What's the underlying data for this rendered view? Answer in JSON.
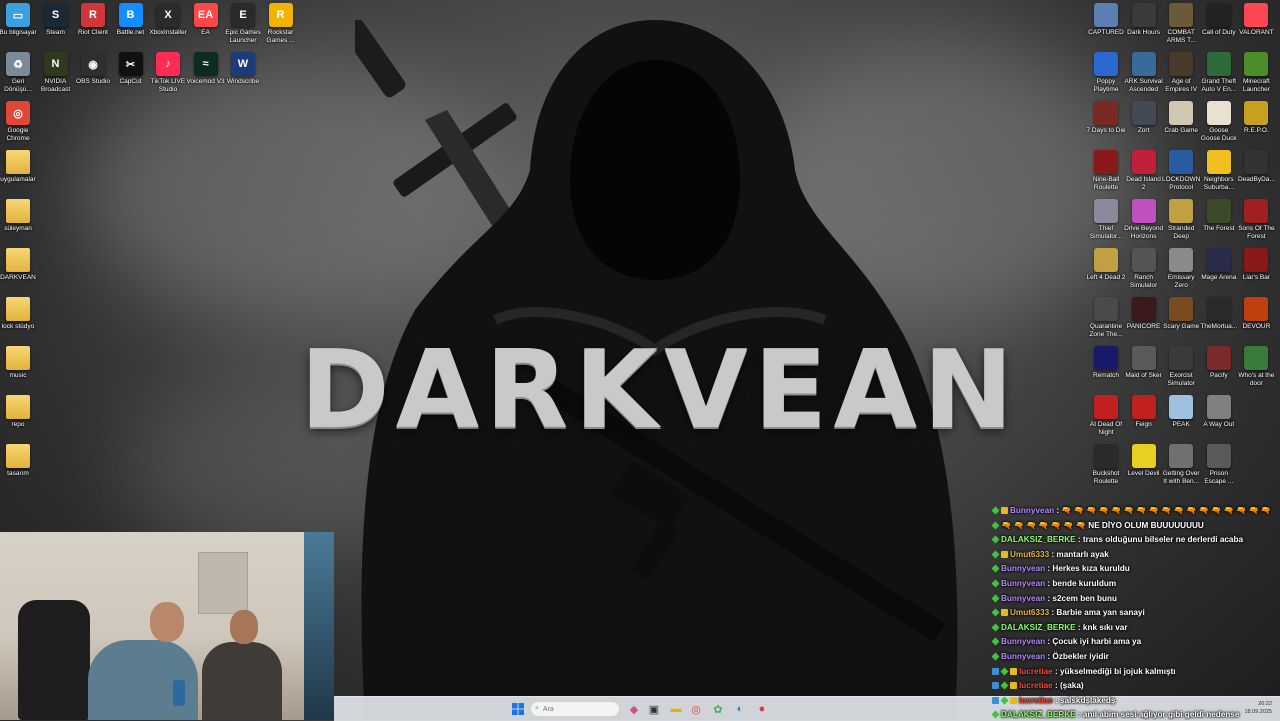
{
  "wallpaper": {
    "title": "DARKVEAN"
  },
  "desktop": {
    "left_icons": [
      {
        "label": "Bu bilgisayar",
        "glyph": "▭",
        "color": "#3aa0e0",
        "icon": "computer-icon"
      },
      {
        "label": "Steam",
        "glyph": "S",
        "color": "#1b2838",
        "icon": "steam-icon"
      },
      {
        "label": "Riot Client",
        "glyph": "R",
        "color": "#d13639",
        "icon": "riot-icon"
      },
      {
        "label": "Battle.net",
        "glyph": "B",
        "color": "#148eff",
        "icon": "battlenet-icon"
      },
      {
        "label": "XboxInstaller",
        "glyph": "X",
        "color": "#2b2b2b",
        "icon": "xbox-icon"
      },
      {
        "label": "EA",
        "glyph": "EA",
        "color": "#ff4747",
        "icon": "ea-icon"
      },
      {
        "label": "Epic Games Launcher",
        "glyph": "E",
        "color": "#2a2a2a",
        "icon": "epic-icon"
      },
      {
        "label": "Rockstar Games ...",
        "glyph": "R",
        "color": "#f0b400",
        "icon": "rockstar-icon"
      },
      {
        "label": "Geri Dönüşü...",
        "glyph": "♻",
        "color": "#7a8a99",
        "icon": "recycle-bin-icon"
      },
      {
        "label": "NVIDIA Broadcast",
        "glyph": "N",
        "color": "#2f3a1d",
        "icon": "nvidia-icon"
      },
      {
        "label": "OBS Studio",
        "glyph": "◉",
        "color": "#302e31",
        "icon": "obs-icon"
      },
      {
        "label": "CapCut",
        "glyph": "✂",
        "color": "#111111",
        "icon": "capcut-icon"
      },
      {
        "label": "TikTok LIVE Studio",
        "glyph": "♪",
        "color": "#fe2c55",
        "icon": "tiktok-icon"
      },
      {
        "label": "Voicemod V3",
        "glyph": "≈",
        "color": "#0b2b25",
        "icon": "voicemod-icon"
      },
      {
        "label": "Windscribe",
        "glyph": "W",
        "color": "#1d3b7a",
        "icon": "windscribe-icon"
      },
      {
        "label": "Google Chrome",
        "glyph": "◎",
        "color": "#e0463a",
        "icon": "chrome-icon"
      },
      {
        "label": "uygulamalar",
        "glyph": "",
        "color": "#f1c24f",
        "icon": "folder-icon"
      },
      {
        "label": "süleyman",
        "glyph": "",
        "color": "#f1c24f",
        "icon": "folder-icon"
      },
      {
        "label": "DARKVEAN",
        "glyph": "",
        "color": "#f1c24f",
        "icon": "folder-icon"
      },
      {
        "label": "lock stüdyo",
        "glyph": "",
        "color": "#f1c24f",
        "icon": "folder-icon"
      },
      {
        "label": "music",
        "glyph": "",
        "color": "#f1c24f",
        "icon": "folder-icon"
      },
      {
        "label": "repo",
        "glyph": "",
        "color": "#f1c24f",
        "icon": "folder-icon"
      },
      {
        "label": "tasarım",
        "glyph": "",
        "color": "#f1c24f",
        "icon": "folder-icon"
      }
    ],
    "right_icons": [
      {
        "label": "CAPTURED",
        "color": "#5a7fb0"
      },
      {
        "label": "Dark Hours",
        "color": "#3a3a3a"
      },
      {
        "label": "COMBAT ARMS T...",
        "color": "#6a5a3a"
      },
      {
        "label": "Call of Duty",
        "color": "#222222"
      },
      {
        "label": "VALORANT",
        "color": "#ff4655"
      },
      {
        "label": "Poppy Playtime",
        "color": "#2a6ad0"
      },
      {
        "label": "ARK Survival Ascended",
        "color": "#3a6a9a"
      },
      {
        "label": "Age of Empires IV",
        "color": "#4a3a2a"
      },
      {
        "label": "Grand Theft Auto V En...",
        "color": "#2f6a3a"
      },
      {
        "label": "Minecraft Launcher",
        "color": "#4c8c2b"
      },
      {
        "label": "7 Days to Die",
        "color": "#7a2a20"
      },
      {
        "label": "Zort",
        "color": "#444a55"
      },
      {
        "label": "Crab Game",
        "color": "#d0c8b0"
      },
      {
        "label": "Goose Goose Duck",
        "color": "#e8e0d0"
      },
      {
        "label": "R.E.P.O.",
        "color": "#c8a020"
      },
      {
        "label": "Nine-Ball Roulette",
        "color": "#8a1a1a"
      },
      {
        "label": "Dead Island 2",
        "color": "#c0203a"
      },
      {
        "label": "LOCKDOWN Protocol",
        "color": "#2a5aa0"
      },
      {
        "label": "Neighbors Suburba...",
        "color": "#f0c020"
      },
      {
        "label": "DeadByDa...",
        "color": "#333333"
      },
      {
        "label": "Thief Simulator...",
        "color": "#8a8a9a"
      },
      {
        "label": "Drive Beyond Horizons",
        "color": "#c050c0"
      },
      {
        "label": "Stranded Deep",
        "color": "#c0a040"
      },
      {
        "label": "The Forest",
        "color": "#3a4a2a"
      },
      {
        "label": "Sons Of The Forest",
        "color": "#a02020"
      },
      {
        "label": "Left 4 Dead 2",
        "color": "#c0a040"
      },
      {
        "label": "Ranch Simulator",
        "color": "#555555"
      },
      {
        "label": "Emissary Zero",
        "color": "#8a8a8a"
      },
      {
        "label": "Mage Arena",
        "color": "#2a2a4a"
      },
      {
        "label": "Liar's Bar",
        "color": "#8a1a1a"
      },
      {
        "label": "Quarantine Zone The...",
        "color": "#4a4a4a"
      },
      {
        "label": "PANICORE",
        "color": "#3a1a1a"
      },
      {
        "label": "Scary Game",
        "color": "#7a4a20"
      },
      {
        "label": "TheMortua...",
        "color": "#2a2a2a"
      },
      {
        "label": "DEVOUR",
        "color": "#c04010"
      },
      {
        "label": "Rematch",
        "color": "#1a1a6a"
      },
      {
        "label": "Maid of Sker",
        "color": "#5a5a5a"
      },
      {
        "label": "Exorcist Simulator",
        "color": "#3a3a3a"
      },
      {
        "label": "Pacify",
        "color": "#7a2a2a"
      },
      {
        "label": "Who's at the door",
        "color": "#3a7a3a"
      },
      {
        "label": "At Dead Of Night",
        "color": "#c02020"
      },
      {
        "label": "Feign",
        "color": "#c02020"
      },
      {
        "label": "PEAK",
        "color": "#a0c0e0"
      },
      {
        "label": "A Way Out",
        "color": "#808080"
      },
      {
        "label": "",
        "color": "transparent"
      },
      {
        "label": "Buckshot Roulette",
        "color": "#2a2a2a"
      },
      {
        "label": "Level Devil",
        "color": "#e8d020"
      },
      {
        "label": "Getting Over It with Ben...",
        "color": "#707070"
      },
      {
        "label": "Prison Escape ...",
        "color": "#5a5a5a"
      },
      {
        "label": "",
        "color": "transparent"
      }
    ]
  },
  "taskbar": {
    "search_placeholder": "Ara",
    "time": "20:22",
    "date": "18.09.2025"
  },
  "chat": [
    {
      "badges": [
        "mod",
        "vip"
      ],
      "user": "Bunnyvean",
      "ucolor": "u-purple",
      "text": ": 🔫 🔫 🔫 🔫 🔫 🔫 🔫 🔫 🔫 🔫 🔫 🔫 🔫 🔫 🔫 🔫 🔫"
    },
    {
      "badges": [
        "mod"
      ],
      "user": "",
      "ucolor": "",
      "text": "🔫 🔫 🔫 🔫 🔫 🔫 🔫 NE DİYO OLUM BUUUUUUUU"
    },
    {
      "badges": [
        "mod"
      ],
      "user": "DALAKSIZ_BERKE",
      "ucolor": "u-green",
      "text": ": trans olduğunu bilseler ne derlerdi acaba"
    },
    {
      "badges": [
        "mod",
        "vip"
      ],
      "user": "Umut6333",
      "ucolor": "u-gold",
      "text": ": mantarlı ayak"
    },
    {
      "badges": [
        "mod"
      ],
      "user": "Bunnyvean",
      "ucolor": "u-purple",
      "text": ": Herkes kıza kuruldu"
    },
    {
      "badges": [
        "mod"
      ],
      "user": "Bunnyvean",
      "ucolor": "u-purple",
      "text": ": bende kuruldum"
    },
    {
      "badges": [
        "mod"
      ],
      "user": "Bunnyvean",
      "ucolor": "u-purple",
      "text": ": s2cem ben bunu"
    },
    {
      "badges": [
        "mod",
        "vip"
      ],
      "user": "Umut6333",
      "ucolor": "u-gold",
      "text": ": Barbie ama yan sanayi"
    },
    {
      "badges": [
        "mod"
      ],
      "user": "DALAKSIZ_BERKE",
      "ucolor": "u-green",
      "text": ": knk sıkı var"
    },
    {
      "badges": [
        "mod"
      ],
      "user": "Bunnyvean",
      "ucolor": "u-purple",
      "text": ": Çocuk iyi harbi ama ya"
    },
    {
      "badges": [
        "mod"
      ],
      "user": "Bunnyvean",
      "ucolor": "u-purple",
      "text": ": Özbekler iyidir"
    },
    {
      "badges": [
        "sub",
        "mod",
        "vip"
      ],
      "user": "lucretiae",
      "ucolor": "u-red",
      "text": ": yükselmediği bi jojuk kalmıştı"
    },
    {
      "badges": [
        "sub",
        "mod",
        "vip"
      ],
      "user": "lucretiae",
      "ucolor": "u-red",
      "text": ": (şaka)"
    },
    {
      "badges": [
        "sub",
        "mod",
        "vip"
      ],
      "user": "lucretiae",
      "ucolor": "u-red",
      "text": ": şalskdşlakedş"
    },
    {
      "badges": [
        "mod"
      ],
      "user": "DALAKSIZ_BERKE",
      "ucolor": "u-green",
      "text": ": anıl abim sesi ağlıyor gibi geldi nedense"
    }
  ]
}
